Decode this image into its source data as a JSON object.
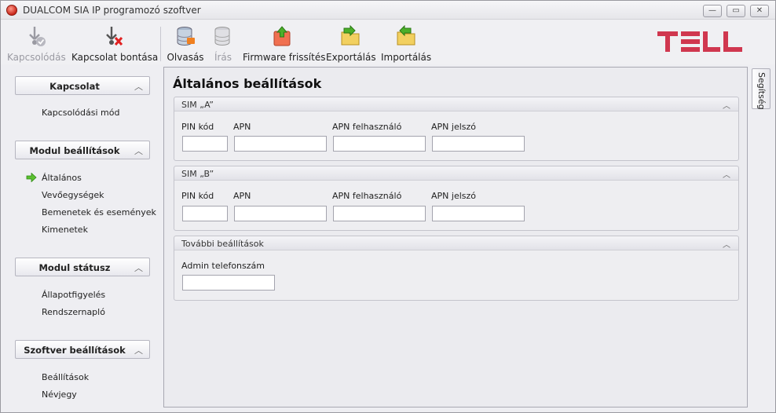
{
  "window": {
    "title": "DUALCOM SIA IP programozó szoftver",
    "controls": {
      "minimize": "—",
      "maximize": "▭",
      "close": "✕"
    }
  },
  "toolbar": {
    "buttons": [
      {
        "label": "Kapcsolódás",
        "icon": "usb-connect-icon",
        "enabled": false
      },
      {
        "label": "Kapcsolat bontása",
        "icon": "usb-disconnect-icon",
        "enabled": true
      },
      {
        "label": "Olvasás",
        "icon": "database-read-icon",
        "enabled": true
      },
      {
        "label": "Írás",
        "icon": "database-write-icon",
        "enabled": false
      },
      {
        "label": "Firmware frissítés",
        "icon": "firmware-upload-icon",
        "enabled": true
      },
      {
        "label": "Exportálás",
        "icon": "folder-export-icon",
        "enabled": true
      },
      {
        "label": "Importálás",
        "icon": "folder-import-icon",
        "enabled": true
      }
    ],
    "logo_text": "TELL",
    "logo_color": "#d0374f"
  },
  "sidebar": {
    "groups": [
      {
        "title": "Kapcsolat",
        "items": [
          "Kapcsolódási mód"
        ]
      },
      {
        "title": "Modul beállítások",
        "items": [
          "Általános",
          "Vevőegységek",
          "Bemenetek és események",
          "Kimenetek"
        ],
        "active_item": "Általános"
      },
      {
        "title": "Modul státusz",
        "items": [
          "Állapotfigyelés",
          "Rendszernapló"
        ]
      },
      {
        "title": "Szoftver beállítások",
        "items": [
          "Beállítások",
          "Névjegy"
        ]
      }
    ]
  },
  "main": {
    "title": "Általános beállítások",
    "sections": [
      {
        "title": "SIM „A”",
        "fields": [
          {
            "label": "PIN kód",
            "value": ""
          },
          {
            "label": "APN",
            "value": ""
          },
          {
            "label": "APN felhasználó",
            "value": ""
          },
          {
            "label": "APN jelszó",
            "value": ""
          }
        ]
      },
      {
        "title": "SIM „B”",
        "fields": [
          {
            "label": "PIN kód",
            "value": ""
          },
          {
            "label": "APN",
            "value": ""
          },
          {
            "label": "APN felhasználó",
            "value": ""
          },
          {
            "label": "APN jelszó",
            "value": ""
          }
        ]
      },
      {
        "title": "További beállítások",
        "fields": [
          {
            "label": "Admin telefonszám",
            "value": ""
          }
        ]
      }
    ]
  },
  "help_tab": {
    "label": "Segítség"
  },
  "colors": {
    "accent_green": "#4caf2a",
    "logo_red": "#d0374f"
  }
}
